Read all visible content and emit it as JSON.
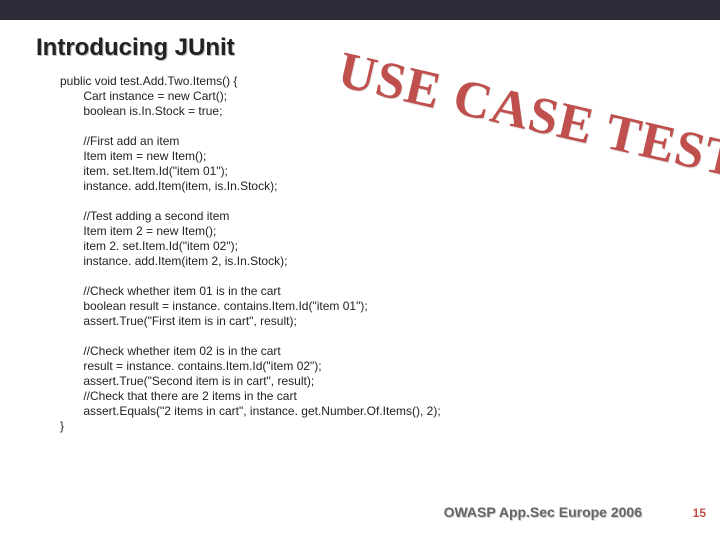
{
  "title": "Introducing JUnit",
  "code_lines": {
    "l01": "public void test.Add.Two.Items() {",
    "l02": "       Cart instance = new Cart();",
    "l03": "       boolean is.In.Stock = true;",
    "l04": "",
    "l05": "       //First add an item",
    "l06": "       Item item = new Item();",
    "l07": "       item. set.Item.Id(\"item 01\");",
    "l08": "       instance. add.Item(item, is.In.Stock);",
    "l09": "",
    "l10": "       //Test adding a second item",
    "l11": "       Item item 2 = new Item();",
    "l12": "       item 2. set.Item.Id(\"item 02\");",
    "l13": "       instance. add.Item(item 2, is.In.Stock);",
    "l14": "",
    "l15": "       //Check whether item 01 is in the cart",
    "l16": "       boolean result = instance. contains.Item.Id(\"item 01\");",
    "l17": "       assert.True(\"First item is in cart\", result);",
    "l18": "",
    "l19": "       //Check whether item 02 is in the cart",
    "l20": "       result = instance. contains.Item.Id(\"item 02\");",
    "l21": "       assert.True(\"Second item is in cart\", result);",
    "l22": "       //Check that there are 2 items in the cart",
    "l23": "       assert.Equals(\"2 items in cart\", instance. get.Number.Of.Items(), 2);",
    "l24": "}"
  },
  "stamp": "USE CASE  TEST",
  "footer": "OWASP App.Sec Europe 2006",
  "page_number": "15"
}
